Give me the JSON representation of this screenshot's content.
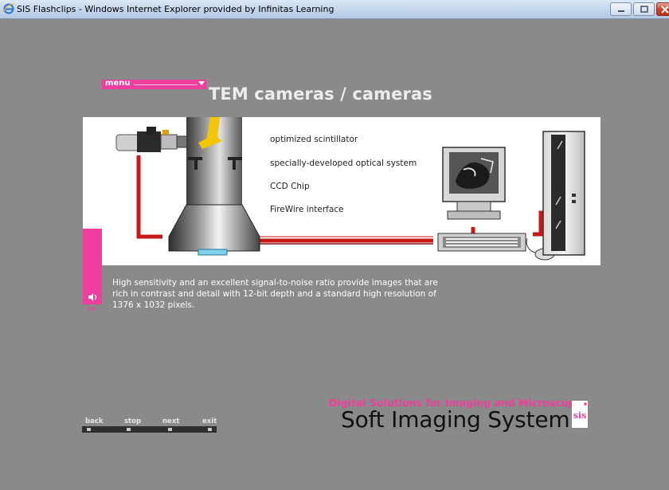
{
  "window": {
    "title": "SIS Flashclips - Windows Internet Explorer provided by Infinitas Learning"
  },
  "menu": {
    "label": "menu"
  },
  "page": {
    "title": "TEM cameras / cameras"
  },
  "features": [
    "optimized scintillator",
    "specially-developed optical system",
    "CCD Chip",
    "FireWire interface"
  ],
  "sound": {
    "state_label": "on"
  },
  "description": "High sensitivity and an excellent signal-to-noise ratio provide images that are rich in contrast and detail with 12-bit depth and a standard high resolution of 1376 x 1032 pixels.",
  "nav": {
    "back": "back",
    "stop": "stop",
    "next": "next",
    "exit": "exit"
  },
  "brand": {
    "tagline": "Digital Solutions for Imaging and Microscopy",
    "name": "Soft Imaging System",
    "logo_text": "sis"
  },
  "colors": {
    "accent": "#ee3f9e",
    "background": "#8a8a8a",
    "cable": "#c41a1a"
  }
}
